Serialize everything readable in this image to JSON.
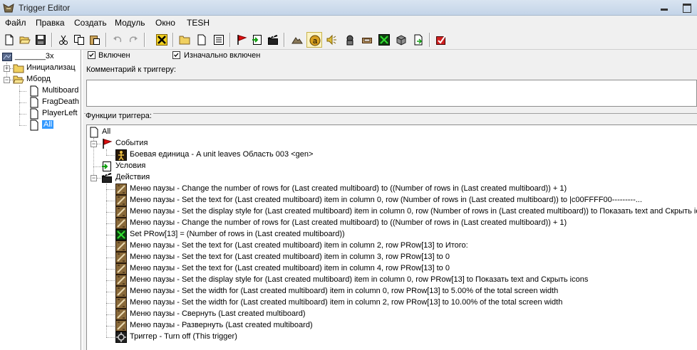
{
  "window": {
    "title": "Trigger Editor"
  },
  "menu": {
    "items": [
      "Файл",
      "Правка",
      "Создать",
      "Модуль",
      "Окно",
      "TESH"
    ]
  },
  "toolbar": {
    "buttons": [
      "new-icon",
      "open-icon",
      "save-icon",
      "cut-icon",
      "copy-icon",
      "paste-icon",
      "undo-icon",
      "redo-icon",
      "delete-icon",
      "new-category-icon",
      "new-trigger-icon",
      "new-comment-icon",
      "new-event-icon",
      "new-condition-icon",
      "new-action-icon",
      "terrain-icon",
      "unit-icon",
      "sound-icon",
      "object-icon",
      "camera-icon",
      "ai-icon",
      "import-icon",
      "export-icon",
      "test-map-icon"
    ]
  },
  "tree": {
    "root_label": "_______3x",
    "nodes": [
      {
        "label": "Инициализац",
        "type": "folder",
        "expanded": false
      },
      {
        "label": "Мборд",
        "type": "folder",
        "expanded": true
      },
      {
        "label": "Multiboard",
        "type": "trigger"
      },
      {
        "label": "FragDeath",
        "type": "trigger"
      },
      {
        "label": "PlayerLeft",
        "type": "trigger"
      },
      {
        "label": "All",
        "type": "trigger",
        "selected": true
      }
    ]
  },
  "trigger": {
    "enabled_label": "Включен",
    "enabled": true,
    "initially_on_label": "Изначально включен",
    "initially_on": true,
    "comment_label": "Комментарий к триггеру:",
    "comment_value": "",
    "functions_label": "Функции триггера:"
  },
  "functions": {
    "root": "All",
    "events_label": "События",
    "events": [
      "Боевая единица - A unit leaves Область 003 <gen>"
    ],
    "conditions_label": "Условия",
    "actions_label": "Действия",
    "actions": [
      {
        "icon": "multiboard-icon",
        "text": "Меню паузы - Change the number of rows for (Last created multiboard) to ((Number of rows in (Last created multiboard)) + 1)"
      },
      {
        "icon": "multiboard-icon",
        "text": "Меню паузы - Set the text for (Last created multiboard) item in column 0, row (Number of rows in (Last created multiboard)) to |c00FFFF00---------..."
      },
      {
        "icon": "multiboard-icon",
        "text": "Меню паузы - Set the display style for (Last created multiboard) item in column 0, row (Number of rows in (Last created multiboard)) to Показать text and Скрыть icons"
      },
      {
        "icon": "multiboard-icon",
        "text": "Меню паузы - Change the number of rows for (Last created multiboard) to ((Number of rows in (Last created multiboard)) + 1)"
      },
      {
        "icon": "set-variable-icon",
        "text": "Set PRow[13] = (Number of rows in (Last created multiboard))"
      },
      {
        "icon": "multiboard-icon",
        "text": "Меню паузы - Set the text for (Last created multiboard) item in column 2, row PRow[13] to Итого:"
      },
      {
        "icon": "multiboard-icon",
        "text": "Меню паузы - Set the text for (Last created multiboard) item in column 3, row PRow[13] to 0"
      },
      {
        "icon": "multiboard-icon",
        "text": "Меню паузы - Set the text for (Last created multiboard) item in column 4, row PRow[13] to 0"
      },
      {
        "icon": "multiboard-icon",
        "text": "Меню паузы - Set the display style for (Last created multiboard) item in column 0, row PRow[13] to Показать text and Скрыть icons"
      },
      {
        "icon": "multiboard-icon",
        "text": "Меню паузы - Set the width for (Last created multiboard) item in column 0, row PRow[13] to 5.00% of the total screen width"
      },
      {
        "icon": "multiboard-icon",
        "text": "Меню паузы - Set the width for (Last created multiboard) item in column 2, row PRow[13] to 10.00% of the total screen width"
      },
      {
        "icon": "multiboard-icon",
        "text": "Меню паузы - Свернуть (Last created multiboard)"
      },
      {
        "icon": "multiboard-icon",
        "text": "Меню паузы - Развернуть (Last created multiboard)"
      },
      {
        "icon": "trigger-icon",
        "text": "Триггер - Turn off (This trigger)"
      }
    ]
  }
}
